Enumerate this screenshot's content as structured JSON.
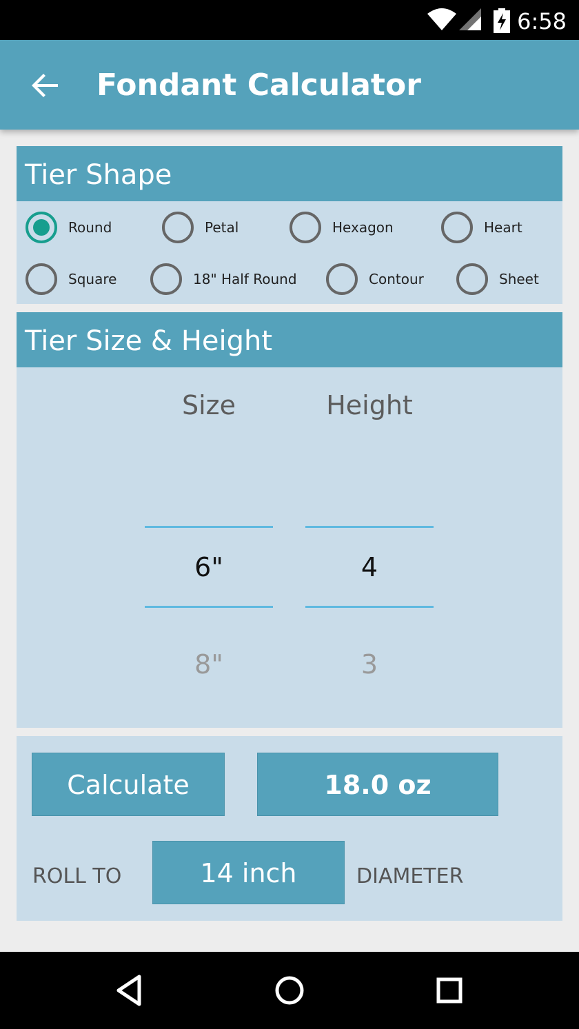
{
  "status_bar": {
    "time": "6:58"
  },
  "app_bar": {
    "title": "Fondant Calculator"
  },
  "tier_shape": {
    "header": "Tier Shape",
    "options": [
      {
        "label": "Round",
        "checked": true
      },
      {
        "label": "Petal",
        "checked": false
      },
      {
        "label": "Hexagon",
        "checked": false
      },
      {
        "label": "Heart",
        "checked": false
      },
      {
        "label": "Square",
        "checked": false
      },
      {
        "label": "18\" Half Round",
        "checked": false
      },
      {
        "label": "Contour",
        "checked": false
      },
      {
        "label": "Sheet",
        "checked": false
      }
    ]
  },
  "tier_size": {
    "header": "Tier Size  &  Height",
    "size_label": "Size",
    "height_label": "Height",
    "size_selected": "6\"",
    "size_next": "8\"",
    "height_selected": "4",
    "height_next": "3"
  },
  "result": {
    "calculate_label": "Calculate",
    "amount": "18.0 oz",
    "roll_to_label": "ROLL TO",
    "diameter_value": "14 inch",
    "diameter_label": "DIAMETER"
  },
  "colors": {
    "primary": "#55a2bb",
    "card_bg": "#c9dce9",
    "accent": "#179e8e",
    "picker_line": "#5fb9e0"
  }
}
